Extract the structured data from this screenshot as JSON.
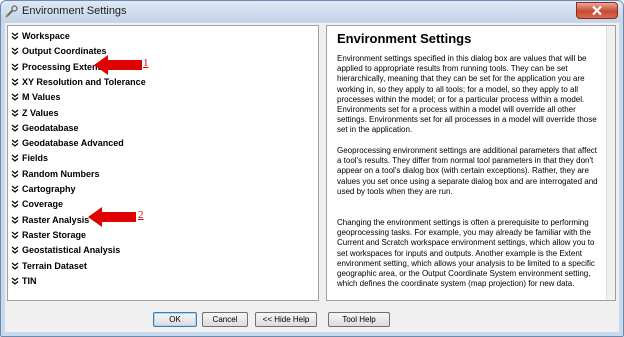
{
  "window": {
    "title": "Environment Settings"
  },
  "tree_items": [
    "Workspace",
    "Output Coordinates",
    "Processing Extent",
    "XY Resolution and Tolerance",
    "M Values",
    "Z Values",
    "Geodatabase",
    "Geodatabase Advanced",
    "Fields",
    "Random Numbers",
    "Cartography",
    "Coverage",
    "Raster Analysis",
    "Raster Storage",
    "Geostatistical Analysis",
    "Terrain Dataset",
    "TIN"
  ],
  "help": {
    "title": "Environment Settings",
    "paragraphs": [
      "Environment settings specified in this dialog box are values that will be applied to appropriate results from running tools. They can be set hierarchically, meaning that they can be set for the application you are working in, so they apply to all tools; for a model, so they apply to all processes within the model; or for a particular process within a model. Environments set for a process within a model will override all other settings. Environments set for all processes in a model will override those set in the application.",
      "Geoprocessing environment settings are additional parameters that affect a tool's results. They differ from normal tool parameters in that they don't appear on a tool's dialog box (with certain exceptions). Rather, they are values you set once using a separate dialog box and are interrogated and used by tools when they are run.",
      "Changing the environment settings is often a prerequisite to performing geoprocessing tasks. For example, you may already be familiar with the Current and Scratch workspace environment settings, which allow you to set workspaces for inputs and outputs. Another example is the Extent environment setting, which allows your analysis to be limited to a specific geographic area, or the Output Coordinate System environment setting, which defines the coordinate system (map projection) for new data."
    ]
  },
  "buttons": {
    "ok": "OK",
    "cancel": "Cancel",
    "hide_help": "<< Hide Help",
    "tool_help": "Tool Help"
  },
  "annotations": [
    {
      "label": "1",
      "target": "Processing Extent"
    },
    {
      "label": "2",
      "target": "Raster Analysis"
    }
  ],
  "colors": {
    "arrow": "#e00000",
    "title_bar": "#c9d9ec",
    "close_button": "#c64a32"
  }
}
